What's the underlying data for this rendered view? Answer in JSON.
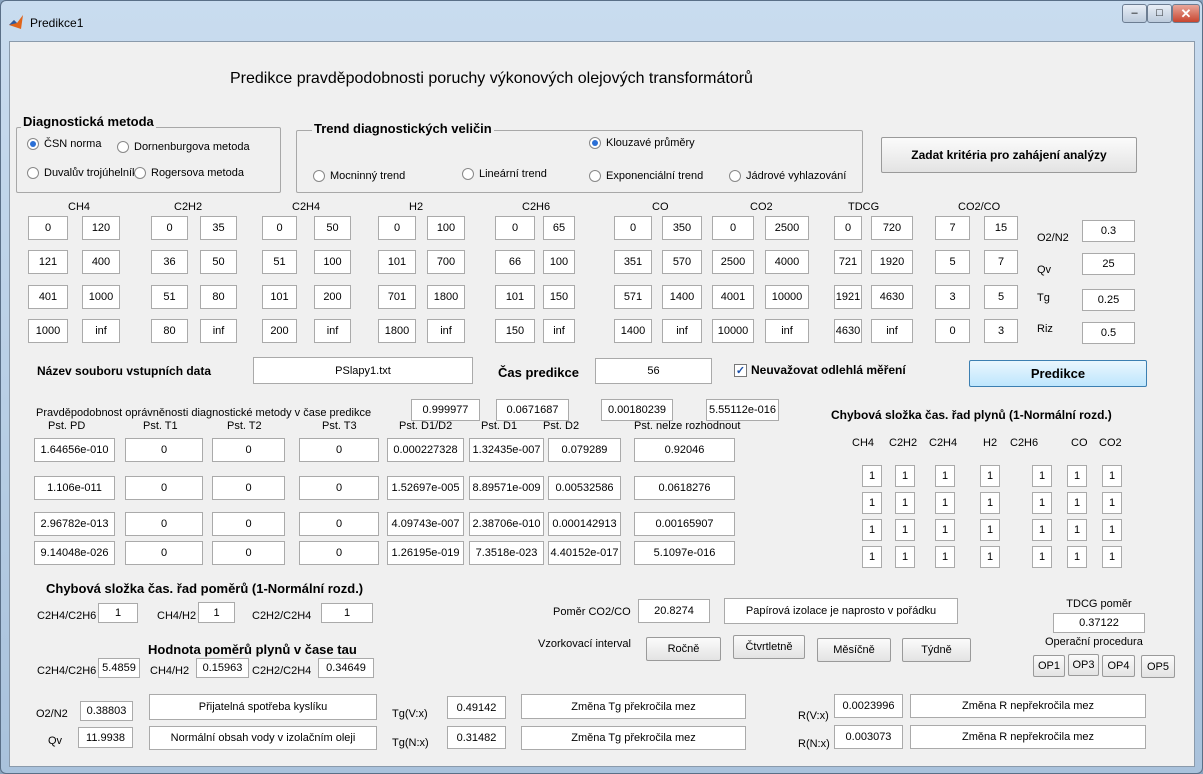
{
  "window": {
    "title": "Predikce1"
  },
  "heading": "Predikce pravděpodobnosti poruchy výkonových olejových transformátorů",
  "diag": {
    "title": "Diagnostická metoda",
    "options": [
      "ČSN norma",
      "Dornenburgova metoda",
      "Duvalův trojúhelník",
      "Rogersova metoda"
    ]
  },
  "trend": {
    "title": "Trend diagnostických veličin",
    "options": [
      "Klouzavé průměry",
      "Mocninný trend",
      "Lineární trend",
      "Exponenciální trend",
      "Jádrové vyhlazování"
    ]
  },
  "criteria_button": "Zadat kritéria pro zahájení analýzy",
  "gas_headers": [
    "CH4",
    "C2H2",
    "C2H4",
    "H2",
    "C2H6",
    "CO",
    "CO2",
    "TDCG",
    "CO2/CO"
  ],
  "gas_limits": [
    [
      "0",
      "120",
      "0",
      "35",
      "0",
      "50",
      "0",
      "100",
      "0",
      "65",
      "0",
      "350",
      "0",
      "2500",
      "0",
      "720",
      "7",
      "15"
    ],
    [
      "121",
      "400",
      "36",
      "50",
      "51",
      "100",
      "101",
      "700",
      "66",
      "100",
      "351",
      "570",
      "2500",
      "4000",
      "721",
      "1920",
      "5",
      "7"
    ],
    [
      "401",
      "1000",
      "51",
      "80",
      "101",
      "200",
      "701",
      "1800",
      "101",
      "150",
      "571",
      "1400",
      "4001",
      "10000",
      "1921",
      "4630",
      "3",
      "5"
    ],
    [
      "1000",
      "inf",
      "80",
      "inf",
      "200",
      "inf",
      "1800",
      "inf",
      "150",
      "inf",
      "1400",
      "inf",
      "10000",
      "inf",
      "4630",
      "inf",
      "0",
      "3"
    ]
  ],
  "side_params": [
    {
      "label": "O2/N2",
      "value": "0.3"
    },
    {
      "label": "Qv",
      "value": "25"
    },
    {
      "label": "Tg",
      "value": "0.25"
    },
    {
      "label": "Riz",
      "value": "0.5"
    }
  ],
  "file": {
    "label": "Název souboru vstupních data",
    "value": "PSlapy1.txt"
  },
  "time": {
    "label": "Čas predikce",
    "value": "56"
  },
  "outliers_label": "Neuvažovat odlehlá měření",
  "predict_button": "Predikce",
  "prob_label": "Pravděpodobnost oprávněnosti diagnostické metody v čase predikce",
  "prob_values": [
    "0.999977",
    "0.0671687",
    "0.00180239",
    "5.55112e-016"
  ],
  "pst_headers": [
    "Pst. PD",
    "Pst. T1",
    "Pst. T2",
    "Pst. T3",
    "Pst. D1/D2",
    "Pst. D1",
    "Pst. D2",
    "Pst. nelze rozhodnout"
  ],
  "pst_rows": [
    [
      "1.64656e-010",
      "0",
      "0",
      "0",
      "0.000227328",
      "1.32435e-007",
      "0.079289",
      "0.92046"
    ],
    [
      "1.106e-011",
      "0",
      "0",
      "0",
      "1.52697e-005",
      "8.89571e-009",
      "0.00532586",
      "0.0618276"
    ],
    [
      "2.96782e-013",
      "0",
      "0",
      "0",
      "4.09743e-007",
      "2.38706e-010",
      "0.000142913",
      "0.00165907"
    ],
    [
      "9.14048e-026",
      "0",
      "0",
      "0",
      "1.26195e-019",
      "7.3518e-023",
      "4.40152e-017",
      "5.1097e-016"
    ]
  ],
  "err_gas": {
    "title": "Chybová složka čas. řad plynů (1-Normální rozd.)",
    "headers": [
      "CH4",
      "C2H2",
      "C2H4",
      "H2",
      "C2H6",
      "CO",
      "CO2"
    ],
    "rows": [
      [
        "1",
        "1",
        "1",
        "1",
        "1",
        "1",
        "1"
      ],
      [
        "1",
        "1",
        "1",
        "1",
        "1",
        "1",
        "1"
      ],
      [
        "1",
        "1",
        "1",
        "1",
        "1",
        "1",
        "1"
      ],
      [
        "1",
        "1",
        "1",
        "1",
        "1",
        "1",
        "1"
      ]
    ]
  },
  "err_ratio": {
    "title": "Chybová složka čas. řad poměrů (1-Normální rozd.)",
    "items": [
      {
        "label": "C2H4/C2H6",
        "value": "1"
      },
      {
        "label": "CH4/H2",
        "value": "1"
      },
      {
        "label": "C2H2/C2H4",
        "value": "1"
      }
    ]
  },
  "ratios_tau": {
    "title": "Hodnota poměrů plynů v čase tau",
    "items": [
      {
        "label": "C2H4/C2H6",
        "value": "5.4859"
      },
      {
        "label": "CH4/H2",
        "value": "0.15963"
      },
      {
        "label": "C2H2/C2H4",
        "value": "0.34649"
      }
    ]
  },
  "co2co": {
    "label": "Poměr CO2/CO",
    "value": "20.8274",
    "status": "Papírová izolace je naprosto v pořádku"
  },
  "tdcg": {
    "label": "TDCG poměr",
    "value": "0.37122"
  },
  "sampling": {
    "label": "Vzorkovací interval",
    "options": [
      "Ročně",
      "Čtvrtletně",
      "Měsíčně",
      "Týdně"
    ]
  },
  "op": {
    "label": "Operační procedura",
    "options": [
      "OP1",
      "OP3",
      "OP4",
      "OP5"
    ]
  },
  "o2n2": {
    "label": "O2/N2",
    "value": "0.38803",
    "status": "Přijatelná spotřeba kyslíku"
  },
  "qv": {
    "label": "Qv",
    "value": "11.9938",
    "status": "Normální obsah vody v izolačním oleji"
  },
  "tgv": {
    "label": "Tg(V:x)",
    "value": "0.49142",
    "status": "Změna Tg překročila mez"
  },
  "tgn": {
    "label": "Tg(N:x)",
    "value": "0.31482",
    "status": "Změna Tg překročila mez"
  },
  "rv": {
    "label": "R(V:x)",
    "value": "0.0023996",
    "status": "Změna R nepřekročila mez"
  },
  "rn": {
    "label": "R(N:x)",
    "value": "0.003073",
    "status": "Změna R nepřekročila mez"
  }
}
